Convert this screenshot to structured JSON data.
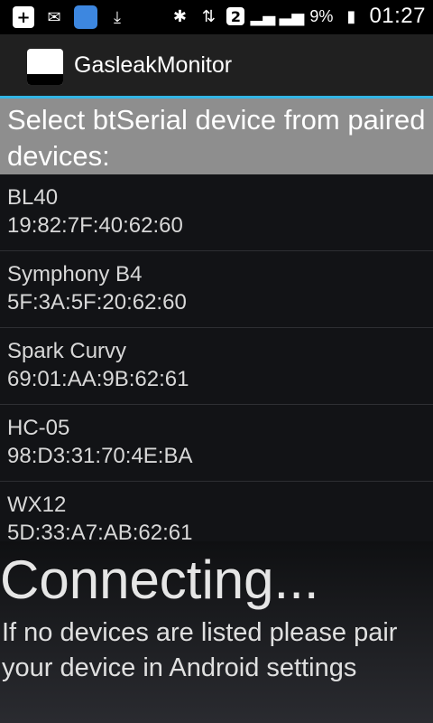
{
  "status_bar": {
    "signal_badge": "2",
    "battery_percent": "9%",
    "time": "01:27",
    "icons": [
      "plus-icon",
      "mail-icon",
      "search-icon",
      "download-icon",
      "bluetooth-icon",
      "data-arrows-icon",
      "signal-icon",
      "signal-icon",
      "battery-icon"
    ]
  },
  "action_bar": {
    "title": "GasleakMonitor"
  },
  "header": {
    "title": "Select btSerial device from paired devices:"
  },
  "devices": [
    {
      "name": "BL40",
      "address": "19:82:7F:40:62:60"
    },
    {
      "name": "Symphony B4",
      "address": "5F:3A:5F:20:62:60"
    },
    {
      "name": "Spark Curvy",
      "address": "69:01:AA:9B:62:61"
    },
    {
      "name": "HC-05",
      "address": "98:D3:31:70:4E:BA"
    },
    {
      "name": "WX12",
      "address": "5D:33:A7:AB:62:61"
    }
  ],
  "footer": {
    "status": "Connecting...",
    "hint": "If no devices are listed please pair your device in Android settings"
  },
  "colors": {
    "accent": "#33b5e5",
    "header_bg": "#8e8e8e"
  }
}
